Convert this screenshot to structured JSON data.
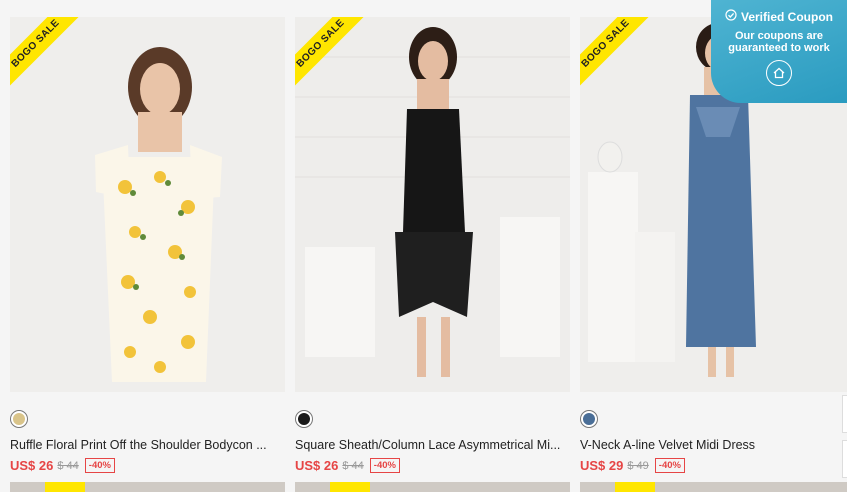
{
  "products": [
    {
      "ribbon": "BOGO SALE",
      "title": "Ruffle Floral Print Off the Shoulder Bodycon ...",
      "price": "US$ 26",
      "old_price": "$ 44",
      "discount": "-40%",
      "swatch_color": "#d9c48a",
      "dress_color": "#fbf6e9",
      "accent_color": "#f2c33a"
    },
    {
      "ribbon": "BOGO SALE",
      "title": "Square Sheath/Column Lace Asymmetrical Mi...",
      "price": "US$ 26",
      "old_price": "$ 44",
      "discount": "-40%",
      "swatch_color": "#1a1a1a",
      "dress_color": "#161616",
      "accent_color": "#2b2b2b"
    },
    {
      "ribbon": "BOGO SALE",
      "title": "V-Neck A-line Velvet Midi Dress",
      "price": "US$ 29",
      "old_price": "$ 49",
      "discount": "-40%",
      "swatch_color": "#4a6e97",
      "dress_color": "#4f74a0",
      "accent_color": "#6a8cb5"
    }
  ],
  "coupon": {
    "title": "Verified Coupon",
    "line1": "Our coupons are",
    "line2": "guaranteed to work"
  }
}
